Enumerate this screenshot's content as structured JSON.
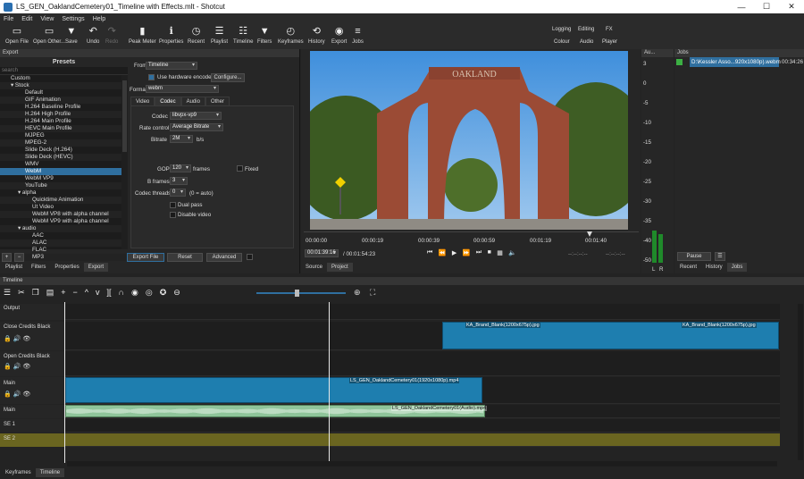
{
  "window": {
    "title": "LS_GEN_OaklandCemetery01_Timeline with Effects.mlt - Shotcut",
    "min": "—",
    "max": "☐",
    "close": "✕"
  },
  "menu": [
    "File",
    "Edit",
    "View",
    "Settings",
    "Help"
  ],
  "toolbar": [
    {
      "label": "Open File",
      "icon": "folder-icon",
      "glyph": "▭"
    },
    {
      "label": "Open Other...",
      "icon": "open-other-icon",
      "glyph": "▭"
    },
    {
      "label": "Save",
      "icon": "save-icon",
      "glyph": "▼"
    },
    {
      "label": "Undo",
      "icon": "undo-icon",
      "glyph": "↶"
    },
    {
      "label": "Redo",
      "icon": "redo-icon",
      "glyph": "↷"
    },
    {
      "label": "Peak Meter",
      "icon": "peak-meter-icon",
      "glyph": "▮"
    },
    {
      "label": "Properties",
      "icon": "properties-icon",
      "glyph": "ℹ"
    },
    {
      "label": "Recent",
      "icon": "recent-icon",
      "glyph": "◷"
    },
    {
      "label": "Playlist",
      "icon": "playlist-icon",
      "glyph": "☰"
    },
    {
      "label": "Timeline",
      "icon": "timeline-icon",
      "glyph": "☷"
    },
    {
      "label": "Filters",
      "icon": "filters-icon",
      "glyph": "▼"
    },
    {
      "label": "Keyframes",
      "icon": "keyframes-icon",
      "glyph": "◴"
    },
    {
      "label": "History",
      "icon": "history-icon",
      "glyph": "⟲"
    },
    {
      "label": "Export",
      "icon": "export-icon",
      "glyph": "◉"
    },
    {
      "label": "Jobs",
      "icon": "jobs-icon",
      "glyph": "≡"
    }
  ],
  "layouts": [
    "Logging",
    "Editing",
    "FX",
    "Colour",
    "Audio",
    "Player"
  ],
  "export": {
    "header": "Export",
    "presets_title": "Presets",
    "search_placeholder": "search",
    "tree": [
      {
        "label": "Custom",
        "indent": 0
      },
      {
        "label": "▾ Stock",
        "indent": 0
      },
      {
        "label": "Default",
        "indent": 2
      },
      {
        "label": "GIF Animation",
        "indent": 2
      },
      {
        "label": "H.264 Baseline Profile",
        "indent": 2
      },
      {
        "label": "H.264 High Profile",
        "indent": 2
      },
      {
        "label": "H.264 Main Profile",
        "indent": 2
      },
      {
        "label": "HEVC Main Profile",
        "indent": 2
      },
      {
        "label": "MJPEG",
        "indent": 2
      },
      {
        "label": "MPEG-2",
        "indent": 2
      },
      {
        "label": "Slide Deck (H.264)",
        "indent": 2
      },
      {
        "label": "Slide Deck (HEVC)",
        "indent": 2
      },
      {
        "label": "WMV",
        "indent": 2
      },
      {
        "label": "WebM",
        "indent": 2,
        "selected": true
      },
      {
        "label": "WebM VP9",
        "indent": 2
      },
      {
        "label": "YouTube",
        "indent": 2
      },
      {
        "label": "▾ alpha",
        "indent": 1
      },
      {
        "label": "Quicktime Animation",
        "indent": 3
      },
      {
        "label": "Ut Video",
        "indent": 3
      },
      {
        "label": "WebM VP8 with alpha channel",
        "indent": 3
      },
      {
        "label": "WebM VP9 with alpha channel",
        "indent": 3
      },
      {
        "label": "▾ audio",
        "indent": 1
      },
      {
        "label": "AAC",
        "indent": 3
      },
      {
        "label": "ALAC",
        "indent": 3
      },
      {
        "label": "FLAC",
        "indent": 3
      },
      {
        "label": "MP3",
        "indent": 3
      }
    ],
    "from_label": "From",
    "from_value": "Timeline",
    "hw_label": "Use hardware encoder",
    "configure": "Configure...",
    "format_label": "Format",
    "format_value": "webm",
    "tabs": [
      "Video",
      "Codec",
      "Audio",
      "Other"
    ],
    "codec_label": "Codec",
    "codec_value": "libvpx-vp9",
    "rate_label": "Rate control",
    "rate_value": "Average Bitrate",
    "bitrate_label": "Bitrate",
    "bitrate_value": "2M",
    "bitrate_unit": "b/s",
    "gop_label": "GOP",
    "gop_value": "120",
    "gop_unit": "frames",
    "fixed_label": "Fixed",
    "bframes_label": "B frames",
    "bframes_value": "3",
    "threads_label": "Codec threads",
    "threads_value": "0",
    "threads_note": "(0 = auto)",
    "dual_pass": "Dual pass",
    "disable_video": "Disable video",
    "export_file": "Export File",
    "reset": "Reset",
    "advanced": "Advanced",
    "bottom_tabs": [
      "Playlist",
      "Filters",
      "Properties",
      "Export"
    ]
  },
  "player": {
    "sign_text": "OAKLAND",
    "ruler": [
      "00:00:00",
      "00:00:19",
      "00:00:39",
      "00:00:59",
      "00:01:19",
      "00:01:40"
    ],
    "position": "00:01:39:16",
    "duration": "/ 00:01:54:23",
    "in_point": "--:--:--:--",
    "out_point": "--:--:--:--",
    "tabs": [
      "Source",
      "Project"
    ]
  },
  "audio": {
    "header": "Au...",
    "scale": [
      "3",
      "0",
      "-5",
      "-10",
      "-15",
      "-20",
      "-25",
      "-30",
      "-35",
      "-40",
      "-50"
    ],
    "channels": [
      "L",
      "R"
    ]
  },
  "jobs": {
    "header": "Jobs",
    "job_name": "D:\\Kessler Asso...920x1080p).webm",
    "job_time": "00:34:26",
    "pause": "Pause",
    "menu_glyph": "☰",
    "tabs": [
      "Recent",
      "History",
      "Jobs"
    ]
  },
  "timeline": {
    "header": "Timeline",
    "tracks": [
      {
        "name": "Output"
      },
      {
        "name": "Close Credits Black"
      },
      {
        "name": "Open Credits Black"
      },
      {
        "name": "Main"
      },
      {
        "name": "Main"
      },
      {
        "name": "SE 1"
      },
      {
        "name": "SE 2"
      }
    ],
    "clips": {
      "credit_1": "KA_Brand_Blank(1200x675p).jpg",
      "credit_2": "KA_Brand_Blank(1200x675p).jpg",
      "main_video": "LS_GEN_OaklandCemetery01(1920x1080p).mp4",
      "main_audio": "LS_GEN_OaklandCemetery01(Audio).mp4"
    },
    "bottom_tabs": [
      "Keyframes",
      "Timeline"
    ]
  }
}
